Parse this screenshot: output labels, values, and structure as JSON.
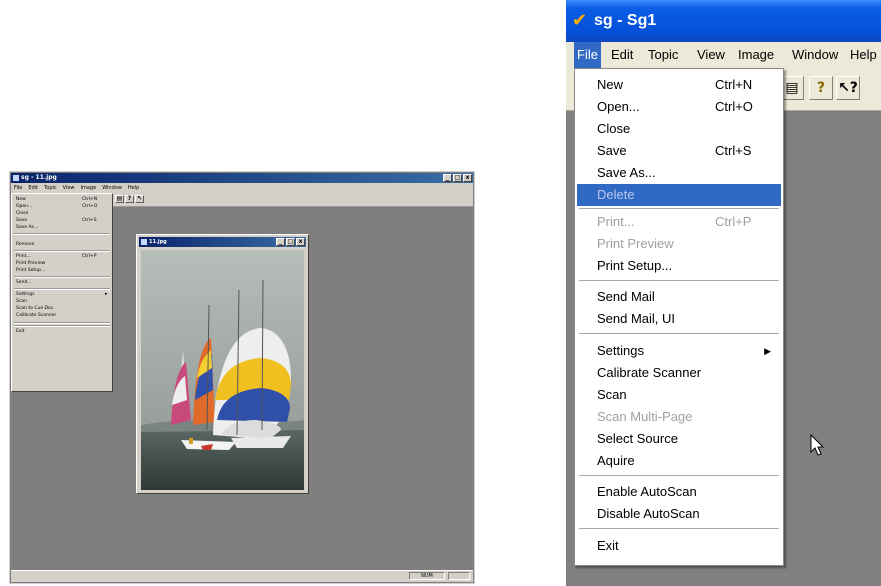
{
  "left_window": {
    "title": "sg - 11.jpg",
    "title_buttons": [
      "_",
      "□",
      "x"
    ],
    "menubar": [
      "File",
      "Edit",
      "Topic",
      "View",
      "Image",
      "Window",
      "Help"
    ],
    "file_menu": [
      {
        "label": "New",
        "shortcut": "Ctrl+N"
      },
      {
        "label": "Open...",
        "shortcut": "Ctrl+O"
      },
      {
        "label": "Close",
        "shortcut": ""
      },
      {
        "label": "Save",
        "shortcut": "Ctrl+S"
      },
      {
        "label": "Save As...",
        "shortcut": ""
      },
      {
        "label": "Remove",
        "shortcut": ""
      },
      {
        "label": "Print...",
        "shortcut": "Ctrl+P"
      },
      {
        "label": "Print Preview",
        "shortcut": ""
      },
      {
        "label": "Print Setup...",
        "shortcut": ""
      },
      {
        "label": "Send...",
        "shortcut": ""
      },
      {
        "label": "Settings",
        "shortcut": ""
      },
      {
        "label": "Scan",
        "shortcut": ""
      },
      {
        "label": "Scan to Cue Doc.",
        "shortcut": ""
      },
      {
        "label": "Calibrate Scanner",
        "shortcut": ""
      },
      {
        "label": "Exit",
        "shortcut": ""
      }
    ],
    "toolbar_icons": [
      "print-icon",
      "help-icon",
      "context-help-icon"
    ],
    "status_num": "NUM",
    "child_window": {
      "title": "11.jpg",
      "title_buttons": [
        "_",
        "□",
        "x"
      ]
    }
  },
  "right_window": {
    "title": "sg - Sg1",
    "menubar": [
      "File",
      "Edit",
      "Topic",
      "View",
      "Image",
      "Window",
      "Help"
    ],
    "file_menu": [
      {
        "label": "New",
        "shortcut": "Ctrl+N",
        "state": "enabled"
      },
      {
        "label": "Open...",
        "shortcut": "Ctrl+O",
        "state": "enabled"
      },
      {
        "label": "Close",
        "shortcut": "",
        "state": "enabled"
      },
      {
        "label": "Save",
        "shortcut": "Ctrl+S",
        "state": "enabled"
      },
      {
        "label": "Save As...",
        "shortcut": "",
        "state": "enabled"
      },
      {
        "label": "Delete",
        "shortcut": "",
        "state": "highlighted-disabled"
      },
      {
        "label": "Print...",
        "shortcut": "Ctrl+P",
        "state": "disabled"
      },
      {
        "label": "Print Preview",
        "shortcut": "",
        "state": "disabled"
      },
      {
        "label": "Print Setup...",
        "shortcut": "",
        "state": "enabled"
      },
      {
        "label": "Send Mail",
        "shortcut": "",
        "state": "enabled"
      },
      {
        "label": "Send Mail, UI",
        "shortcut": "",
        "state": "enabled"
      },
      {
        "label": "Settings",
        "shortcut": "",
        "state": "submenu"
      },
      {
        "label": "Calibrate Scanner",
        "shortcut": "",
        "state": "enabled"
      },
      {
        "label": "Scan",
        "shortcut": "",
        "state": "enabled"
      },
      {
        "label": "Scan Multi-Page",
        "shortcut": "",
        "state": "disabled"
      },
      {
        "label": "Select Source",
        "shortcut": "",
        "state": "enabled"
      },
      {
        "label": "Aquire",
        "shortcut": "",
        "state": "enabled"
      },
      {
        "label": "Enable AutoScan",
        "shortcut": "",
        "state": "enabled"
      },
      {
        "label": "Disable AutoScan",
        "shortcut": "",
        "state": "enabled"
      },
      {
        "label": "Exit",
        "shortcut": "",
        "state": "enabled"
      }
    ],
    "toolbar_icons": [
      "print-icon",
      "help-icon",
      "context-help-icon"
    ]
  },
  "colors": {
    "xp_title": "#0550d8",
    "menu_highlight": "#316ac5",
    "mdi_background": "#808080",
    "disabled_text": "#a0a0a0"
  }
}
